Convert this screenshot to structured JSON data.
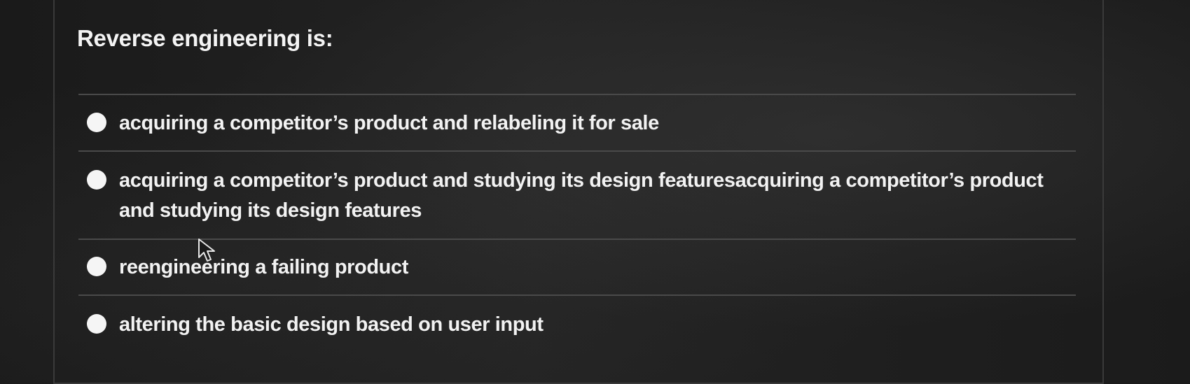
{
  "question": {
    "text": "Reverse engineering is:"
  },
  "options": [
    {
      "label": "acquiring a competitor’s product and relabeling it for sale"
    },
    {
      "label": "acquiring a competitor’s product and studying its design featuresacquiring a competitor’s product and studying its design features"
    },
    {
      "label": "reengineering a failing product"
    },
    {
      "label": "altering the basic design based on user input"
    }
  ],
  "colors": {
    "background": "#121212",
    "text": "#f2f2f2",
    "radio": "#f5f5f5",
    "divider": "#4a4a4a"
  },
  "icons": {
    "cursor": "mouse-pointer-icon"
  }
}
